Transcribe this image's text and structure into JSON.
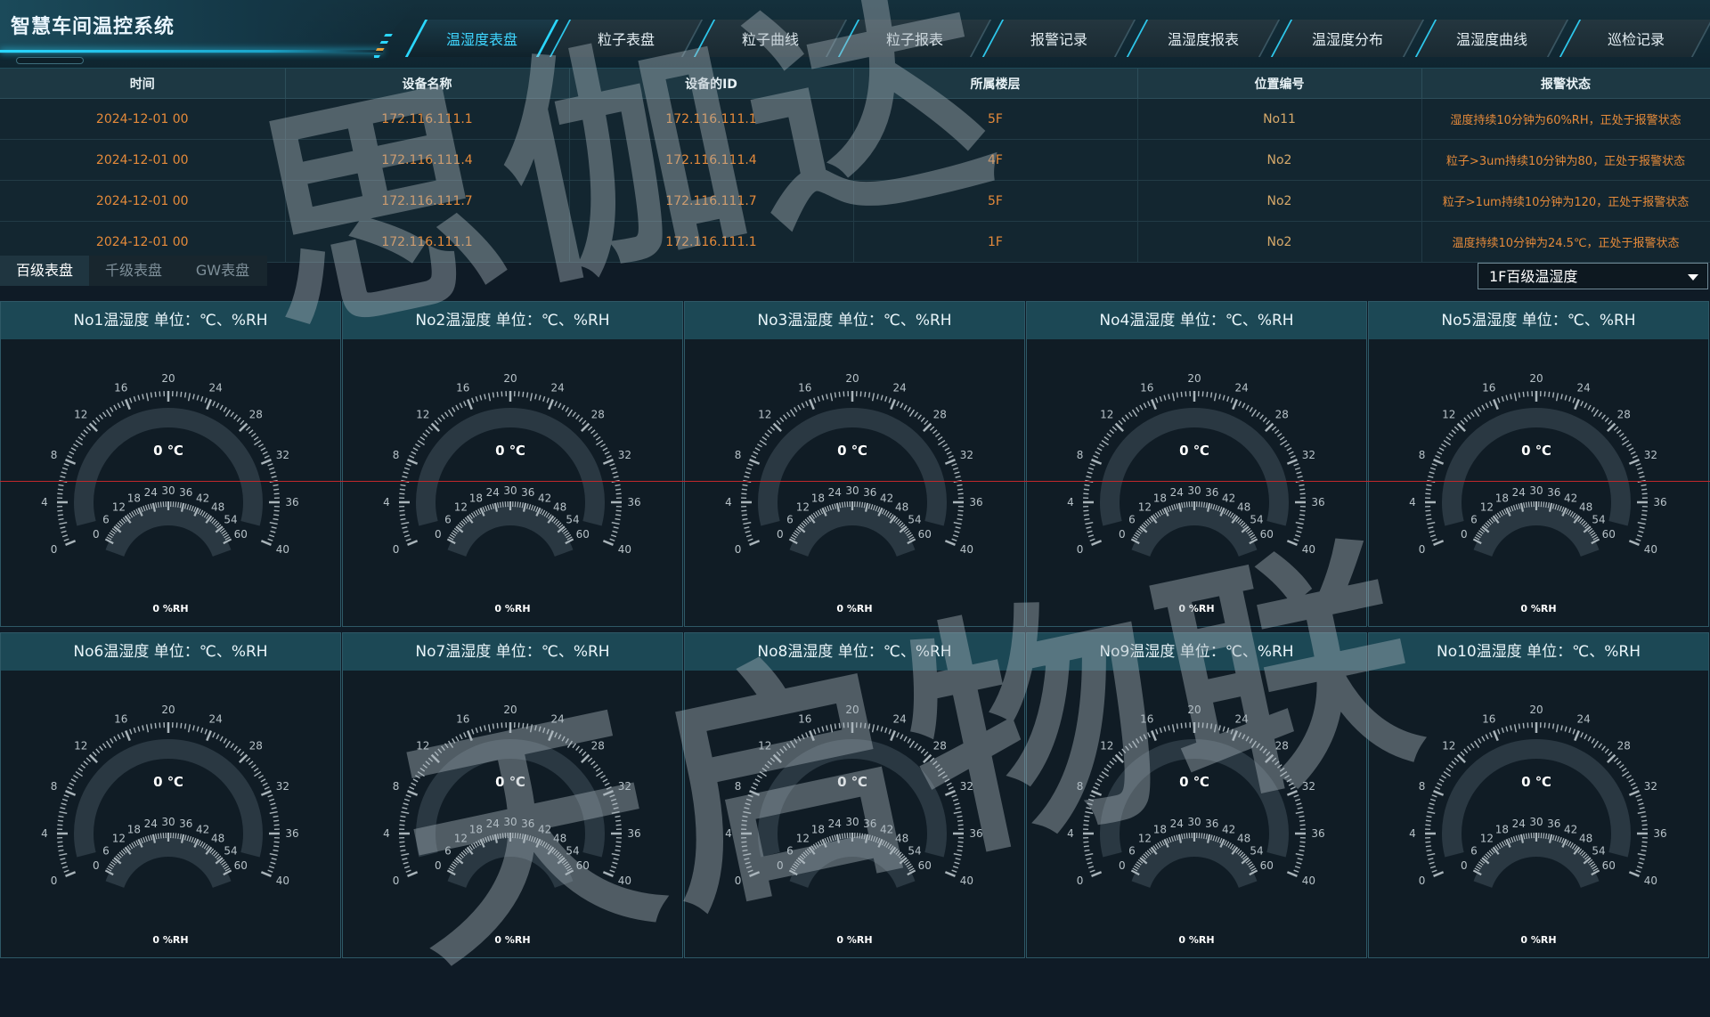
{
  "header": {
    "title": "智慧车间温控系统",
    "tabs": [
      {
        "label": "温湿度表盘",
        "active": true
      },
      {
        "label": "粒子表盘",
        "active": false
      },
      {
        "label": "粒子曲线",
        "active": false
      },
      {
        "label": "粒子报表",
        "active": false
      },
      {
        "label": "报警记录",
        "active": false
      },
      {
        "label": "温湿度报表",
        "active": false
      },
      {
        "label": "温湿度分布",
        "active": false
      },
      {
        "label": "温湿度曲线",
        "active": false
      },
      {
        "label": "巡检记录",
        "active": false
      }
    ]
  },
  "alarm_table": {
    "columns": [
      "时间",
      "设备名称",
      "设备的ID",
      "所属楼层",
      "位置编号",
      "报警状态"
    ],
    "rows": [
      [
        "2024-12-01 00",
        "172.116.111.1",
        "172.116.111.1",
        "5F",
        "No11",
        "湿度持续10分钟为60%RH，正处于报警状态"
      ],
      [
        "2024-12-01 00",
        "172.116.111.4",
        "172.116.111.4",
        "4F",
        "No2",
        "粒子>3um持续10分钟为80，正处于报警状态"
      ],
      [
        "2024-12-01 00",
        "172.116.111.7",
        "172.116.111.7",
        "5F",
        "No2",
        "粒子>1um持续10分钟为120，正处于报警状态"
      ],
      [
        "2024-12-01 00",
        "172.116.111.1",
        "172.116.111.1",
        "1F",
        "No2",
        "温度持续10分钟为24.5℃，正处于报警状态"
      ]
    ]
  },
  "sub_tabs": [
    {
      "label": "百级表盘",
      "active": true
    },
    {
      "label": "千级表盘",
      "active": false
    },
    {
      "label": "GW表盘",
      "active": false
    }
  ],
  "floor_select": {
    "value": "1F百级温湿度"
  },
  "gauge_scale": {
    "temp_ticks": [
      "0",
      "4",
      "8",
      "12",
      "16",
      "20",
      "24",
      "28",
      "32",
      "36",
      "40"
    ],
    "temp_range": [
      0,
      40
    ],
    "hum_ticks": [
      "0",
      "6",
      "12",
      "18",
      "24",
      "30",
      "36",
      "42",
      "48",
      "54",
      "60"
    ],
    "hum_range": [
      0,
      60
    ]
  },
  "gauges": [
    {
      "title": "No1温湿度  单位：℃、%RH",
      "temp": 0,
      "temp_text": "0 ℃",
      "hum": 0,
      "hum_text": "0 %RH"
    },
    {
      "title": "No2温湿度  单位：℃、%RH",
      "temp": 0,
      "temp_text": "0 ℃",
      "hum": 0,
      "hum_text": "0 %RH"
    },
    {
      "title": "No3温湿度  单位：℃、%RH",
      "temp": 0,
      "temp_text": "0 ℃",
      "hum": 0,
      "hum_text": "0 %RH"
    },
    {
      "title": "No4温湿度  单位：℃、%RH",
      "temp": 0,
      "temp_text": "0 ℃",
      "hum": 0,
      "hum_text": "0 %RH"
    },
    {
      "title": "No5温湿度  单位：℃、%RH",
      "temp": 0,
      "temp_text": "0 ℃",
      "hum": 0,
      "hum_text": "0 %RH"
    },
    {
      "title": "No6温湿度  单位：℃、%RH",
      "temp": 0,
      "temp_text": "0 ℃",
      "hum": 0,
      "hum_text": "0 %RH"
    },
    {
      "title": "No7温湿度  单位：℃、%RH",
      "temp": 0,
      "temp_text": "0 ℃",
      "hum": 0,
      "hum_text": "0 %RH"
    },
    {
      "title": "No8温湿度  单位：℃、%RH",
      "temp": 0,
      "temp_text": "0 ℃",
      "hum": 0,
      "hum_text": "0 %RH"
    },
    {
      "title": "No9温湿度  单位：℃、%RH",
      "temp": 0,
      "temp_text": "0 ℃",
      "hum": 0,
      "hum_text": "0 %RH"
    },
    {
      "title": "No10温湿度  单位：℃、%RH",
      "temp": 0,
      "temp_text": "0 ℃",
      "hum": 0,
      "hum_text": "0 %RH"
    }
  ],
  "watermark": {
    "line1": "思伽达",
    "line2": "天启物联"
  },
  "colors": {
    "accent": "#2ad7ff",
    "alarm_text": "#e58a3a",
    "panel_header": "#1c4855",
    "gauge_ring": "#2a3842",
    "tick": "#a9b4ba",
    "marker_line": "#c0282b"
  }
}
